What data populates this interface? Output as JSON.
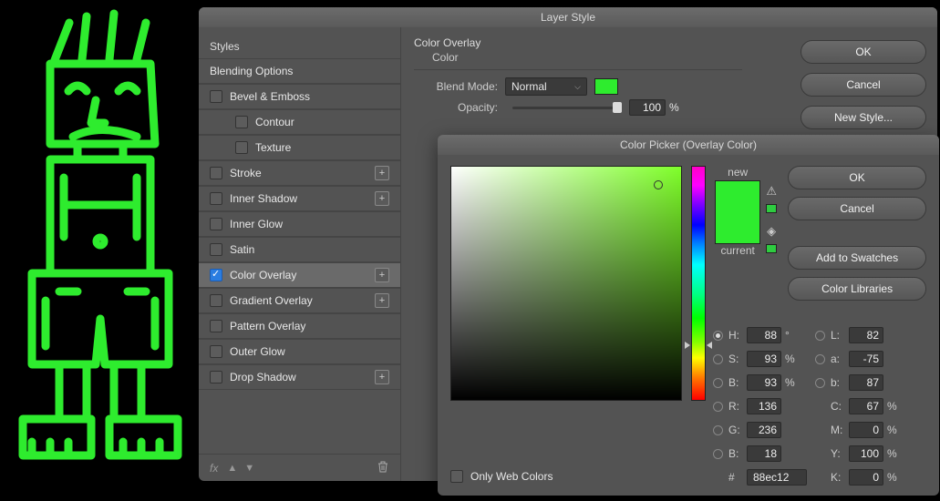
{
  "canvas_art_color": "#2eec2e",
  "layerStyle": {
    "title": "Layer Style",
    "sidebar": {
      "stylesHeader": "Styles",
      "blendingOptions": "Blending Options",
      "items": [
        {
          "label": "Bevel & Emboss",
          "checked": false,
          "plus": false,
          "sub": false
        },
        {
          "label": "Contour",
          "checked": false,
          "plus": false,
          "sub": true
        },
        {
          "label": "Texture",
          "checked": false,
          "plus": false,
          "sub": true
        },
        {
          "label": "Stroke",
          "checked": false,
          "plus": true,
          "sub": false
        },
        {
          "label": "Inner Shadow",
          "checked": false,
          "plus": true,
          "sub": false
        },
        {
          "label": "Inner Glow",
          "checked": false,
          "plus": false,
          "sub": false
        },
        {
          "label": "Satin",
          "checked": false,
          "plus": false,
          "sub": false
        },
        {
          "label": "Color Overlay",
          "checked": true,
          "plus": true,
          "sub": false,
          "selected": true
        },
        {
          "label": "Gradient Overlay",
          "checked": false,
          "plus": true,
          "sub": false
        },
        {
          "label": "Pattern Overlay",
          "checked": false,
          "plus": false,
          "sub": false
        },
        {
          "label": "Outer Glow",
          "checked": false,
          "plus": false,
          "sub": false
        },
        {
          "label": "Drop Shadow",
          "checked": false,
          "plus": true,
          "sub": false
        }
      ],
      "fxLabel": "fx"
    },
    "main": {
      "sectionTitle": "Color Overlay",
      "subTitle": "Color",
      "blendModeLabel": "Blend Mode:",
      "blendModeValue": "Normal",
      "opacityLabel": "Opacity:",
      "opacityValue": "100",
      "opacityUnit": "%",
      "swatchColor": "#2eec2e"
    },
    "buttons": {
      "ok": "OK",
      "cancel": "Cancel",
      "newStyle": "New Style..."
    }
  },
  "colorPicker": {
    "title": "Color Picker (Overlay Color)",
    "newLabel": "new",
    "currentLabel": "current",
    "newColor": "#2eec2e",
    "currentColor": "#2eec2e",
    "buttons": {
      "ok": "OK",
      "cancel": "Cancel",
      "addSwatches": "Add to Swatches",
      "colorLibraries": "Color Libraries"
    },
    "onlyWebColors": "Only Web Colors",
    "hsb": {
      "H": "88",
      "Hunit": "°",
      "S": "93",
      "Sunit": "%",
      "B": "93",
      "Bunit": "%"
    },
    "lab": {
      "L": "82",
      "a": "-75",
      "b": "87"
    },
    "rgb": {
      "R": "136",
      "G": "236",
      "B": "18"
    },
    "cmyk": {
      "C": "67",
      "M": "0",
      "Y": "100",
      "K": "0",
      "unit": "%"
    },
    "hexLabel": "#",
    "hexValue": "88ec12"
  }
}
